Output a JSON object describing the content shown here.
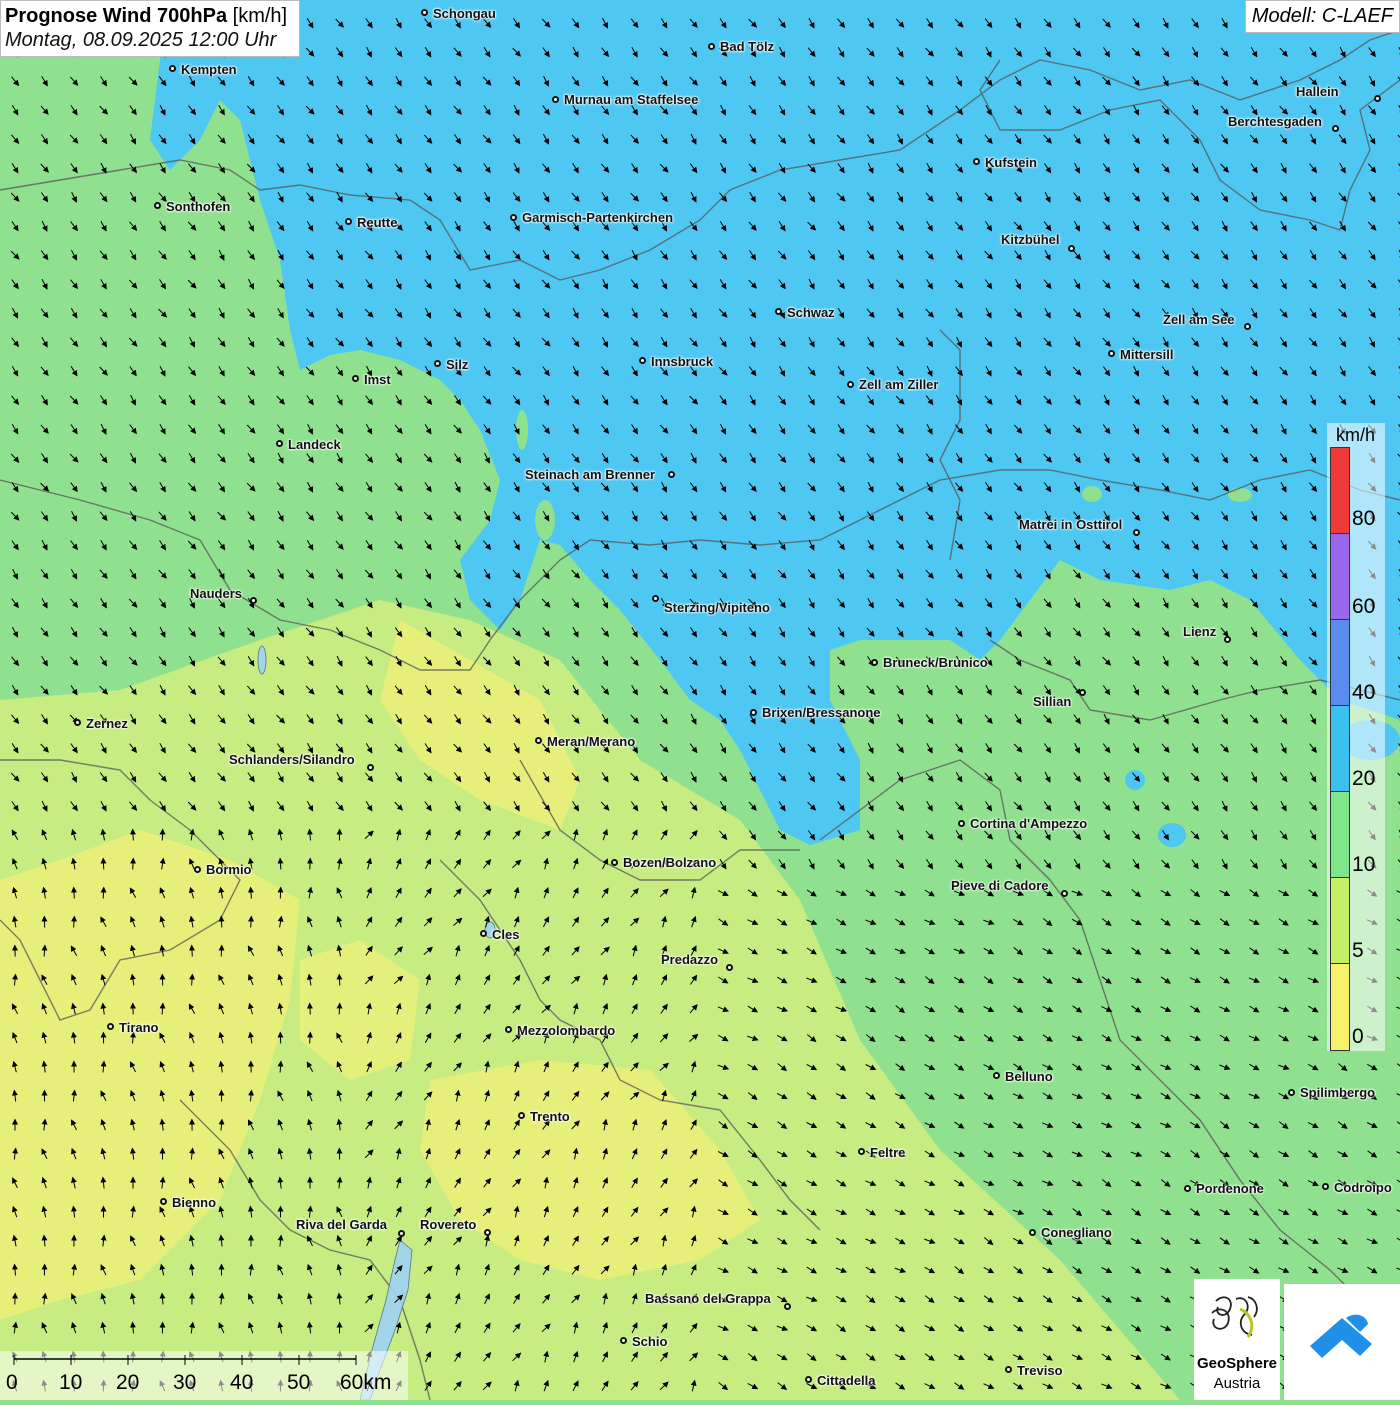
{
  "title": {
    "main_bold": "Prognose Wind 700hPa",
    "main_unit": "[km/h]",
    "date": "Montag, 08.09.2025 12:00 Uhr"
  },
  "model_label": "Modell: C-LAEF",
  "legend": {
    "unit": "km/h",
    "steps": [
      {
        "label": "80",
        "color": "#f03a3a"
      },
      {
        "label": "60",
        "color": "#9966ee"
      },
      {
        "label": "40",
        "color": "#5a8cf0"
      },
      {
        "label": "20",
        "color": "#3cc0ee"
      },
      {
        "label": "10",
        "color": "#80e68c"
      },
      {
        "label": "5",
        "color": "#c4f066"
      },
      {
        "label": "0",
        "color": "#f6f26a"
      }
    ]
  },
  "scalebar": {
    "labels": [
      "0",
      "10",
      "20",
      "30",
      "40",
      "50",
      "60km"
    ]
  },
  "logo": {
    "name_line1": "GeoSphere",
    "name_line2": "Austria"
  },
  "colors": {
    "fill_blue": "#4ec7f2",
    "fill_green": "#8fe08f",
    "fill_yellow": "#eaf07a",
    "fill_yellowgreen": "#c6ec82"
  },
  "cities": [
    {
      "name": "Schongau"
    },
    {
      "name": "Bad Tölz"
    },
    {
      "name": "Kempten"
    },
    {
      "name": "Murnau am Staffelsee"
    },
    {
      "name": "Hallein"
    },
    {
      "name": "Berchtesgaden"
    },
    {
      "name": "Kufstein"
    },
    {
      "name": "Sonthofen"
    },
    {
      "name": "Reutte"
    },
    {
      "name": "Garmisch-Partenkirchen"
    },
    {
      "name": "Kitzbühel"
    },
    {
      "name": "Schwaz"
    },
    {
      "name": "Zell am See"
    },
    {
      "name": "Innsbruck"
    },
    {
      "name": "Mittersill"
    },
    {
      "name": "Silz"
    },
    {
      "name": "Imst"
    },
    {
      "name": "Zell am Ziller"
    },
    {
      "name": "Landeck"
    },
    {
      "name": "Steinach am Brenner"
    },
    {
      "name": "Matrei in Osttirol"
    },
    {
      "name": "Nauders"
    },
    {
      "name": "Sterzing/Vipiteno"
    },
    {
      "name": "Lienz"
    },
    {
      "name": "Bruneck/Brunico"
    },
    {
      "name": "Sillian"
    },
    {
      "name": "Brixen/Bressanone"
    },
    {
      "name": "Zernez"
    },
    {
      "name": "Meran/Merano"
    },
    {
      "name": "Schlanders/Silandro"
    },
    {
      "name": "Cortina d'Ampezzo"
    },
    {
      "name": "Bozen/Bolzano"
    },
    {
      "name": "Bormio"
    },
    {
      "name": "Pieve di Cadore"
    },
    {
      "name": "Cles"
    },
    {
      "name": "Predazzo"
    },
    {
      "name": "Tirano"
    },
    {
      "name": "Mezzolombardo"
    },
    {
      "name": "Belluno"
    },
    {
      "name": "Spilimbergo"
    },
    {
      "name": "Trento"
    },
    {
      "name": "Feltre"
    },
    {
      "name": "Pordenone"
    },
    {
      "name": "Codroipo"
    },
    {
      "name": "Bienno"
    },
    {
      "name": "Riva del Garda"
    },
    {
      "name": "Rovereto"
    },
    {
      "name": "Conegliano"
    },
    {
      "name": "Bassano del Grappa"
    },
    {
      "name": "Schio"
    },
    {
      "name": "Treviso"
    },
    {
      "name": "Cittadella"
    }
  ]
}
